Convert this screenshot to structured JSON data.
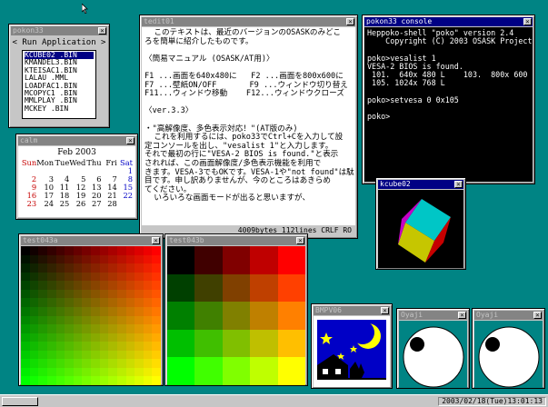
{
  "windows": {
    "pokon": {
      "title": "pokon33",
      "close": "×",
      "header": "< Run Application >",
      "items": [
        "KCUBE02 .BIN",
        "KMANDEL3.BIN",
        "KTEISAC1.BIN",
        "LALAU   .MML",
        "LOADFAC1.BIN",
        "MCOPYC1 .BIN",
        "MMLPLAY .BIN",
        "MCKEY   .BIN"
      ]
    },
    "cal": {
      "title": "calm",
      "close": "×",
      "month": "Feb 2003",
      "days": [
        "Sun",
        "Mon",
        "Tue",
        "Wed",
        "Thu",
        "Fri",
        "Sat"
      ],
      "dates": [
        "",
        "",
        "",
        "",
        "",
        "",
        "1",
        "2",
        "3",
        "4",
        "5",
        "6",
        "7",
        "8",
        "9",
        "10",
        "11",
        "12",
        "13",
        "14",
        "15",
        "16",
        "17",
        "18",
        "19",
        "20",
        "21",
        "22",
        "23",
        "24",
        "25",
        "26",
        "27",
        "28",
        ""
      ]
    },
    "tedit": {
      "title": "tedit01",
      "close": "×",
      "lines": [
        "  このテキストは、最近のバージョンのOSASKのみどこ",
        "ろを簡単に紹介したものです。",
        "",
        "〈簡易マニュアル (OSASK/AT用)〉",
        "",
        "F1 ...画面を640x480に   F2 ...画面を800x600に",
        "F7 ...壁紙ON/OFF       F9 ...ウィンドウ切り替え",
        "F11...ウィンドウ移動    F12...ウィンドウクローズ",
        "",
        "〈ver.3.3〉",
        "",
        "・\"高解像度、多色表示対応！\"(AT版のみ)",
        "  これを利用するには、poko33でCtrl+Cを入力して設",
        "定コンソールを出し、\"vesalist 1\"と入力します。",
        "それで最初の行に\"VESA-2 BIOS is found.\"と表示",
        "されれば、この画面解像度/多色表示機能を利用で",
        "きます。VESA-3でもOKです。VESA-1や\"not found\"は駄",
        "目です。申し訳ありませんが、今のところはあきらめ",
        "てください。",
        "  いろいろな画面モードが出ると思いますが、"
      ],
      "status": "4009bytes  112lines CRLF RO"
    },
    "cons": {
      "title": "pokon33 console",
      "close": "×",
      "lines": [
        "Heppoko-shell \"poko\" version 2.4",
        "    Copyright (C) 2003 OSASK Project",
        "",
        "poko>vesalist 1",
        "VESA-2 BIOS is found.",
        " 101.  640x 480 L    103.  800x 600 L",
        " 105. 1024x 768 L",
        "",
        "poko>setvesa 0 0x105",
        "",
        "poko>"
      ]
    },
    "kcube": {
      "title": "kcube02",
      "close": "×"
    },
    "t43a": {
      "title": "test043a",
      "close": "×"
    },
    "t43b": {
      "title": "test043b",
      "close": "×"
    },
    "bmp": {
      "title": "BMPV06",
      "close": "×"
    },
    "oya1": {
      "title": "Oyaji",
      "close": "×"
    },
    "oya2": {
      "title": "Oyaji",
      "close": "×"
    }
  },
  "taskbar": {
    "clock": "2003/02/18(Tue)13:01:13"
  },
  "colors": {
    "desktop": "#008484",
    "active_title": "#000084",
    "inactive_title": "#848484"
  }
}
